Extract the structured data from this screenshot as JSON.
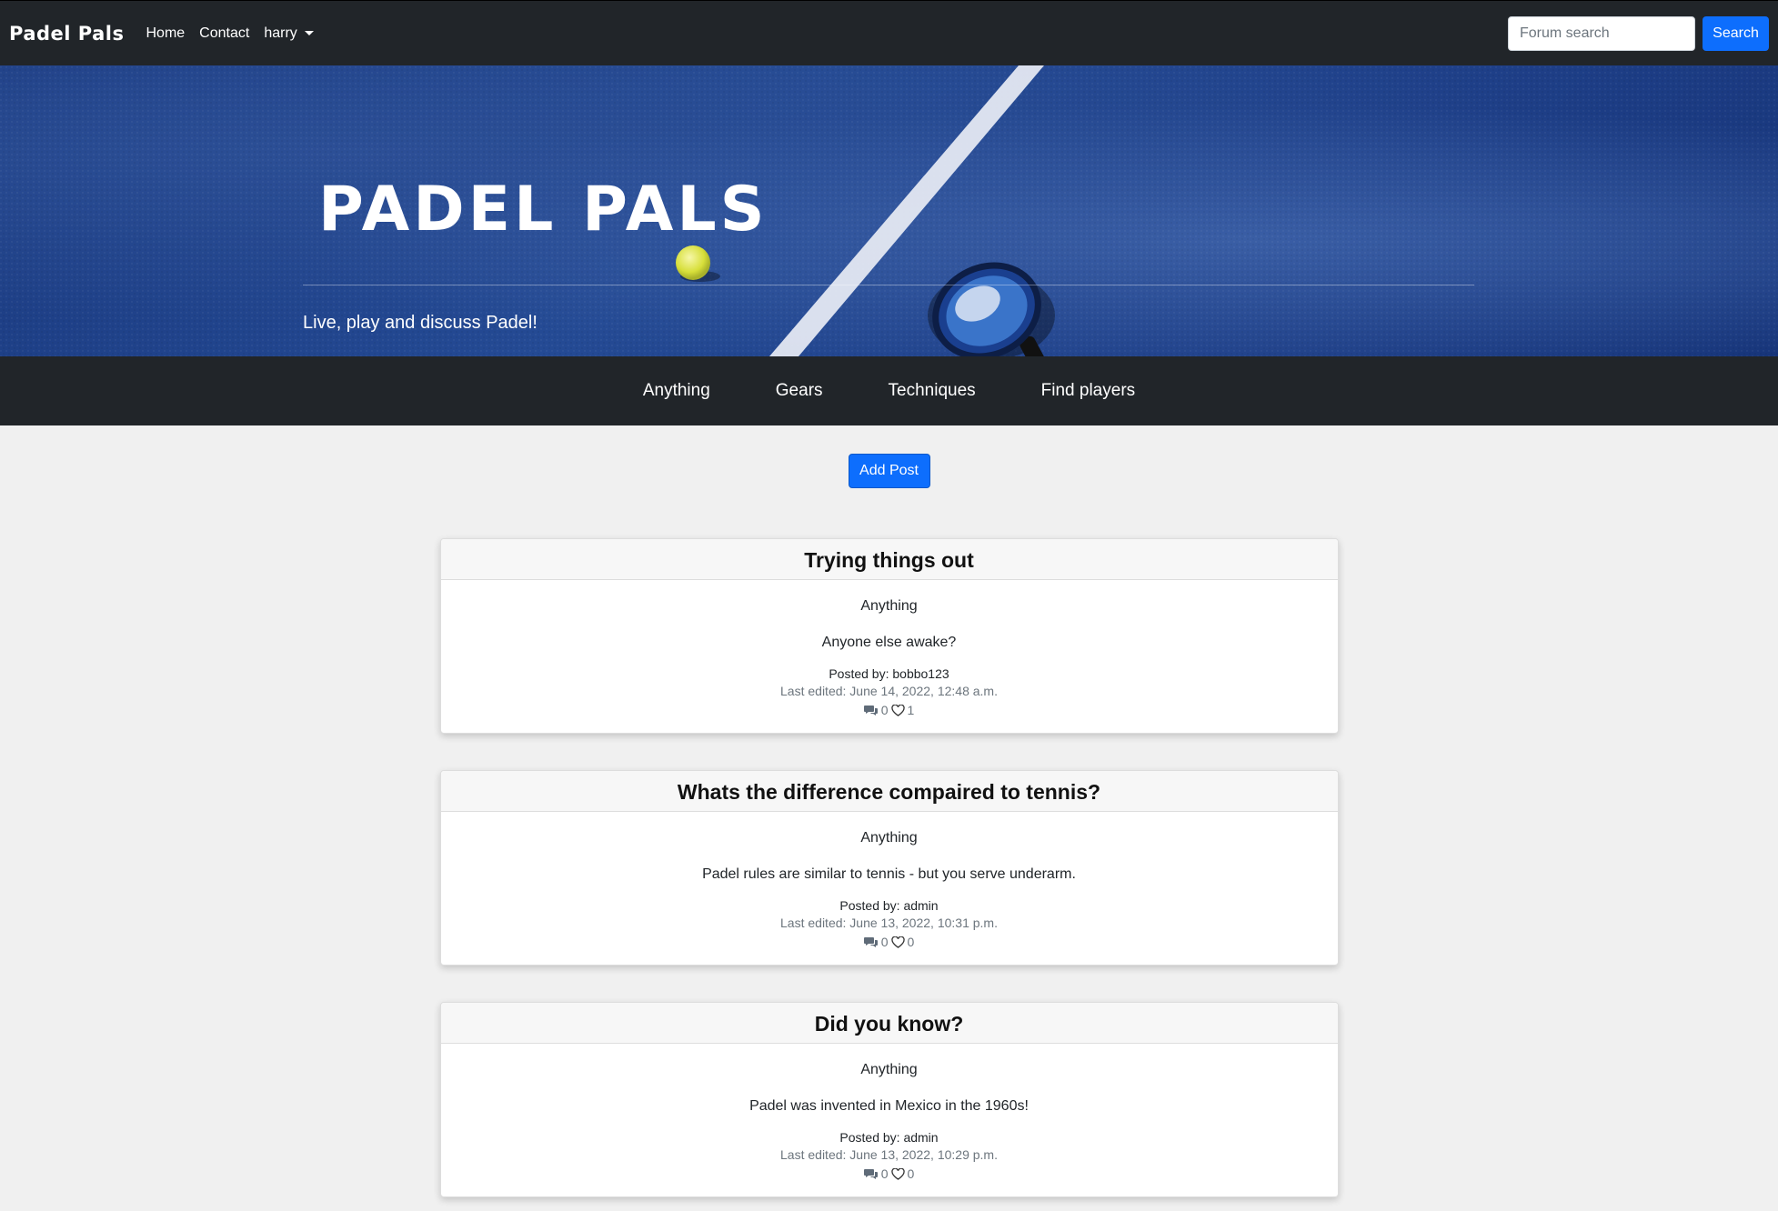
{
  "navbar": {
    "brand": "Padel Pals",
    "links": {
      "home": "Home",
      "contact": "Contact",
      "user": "harry"
    },
    "search": {
      "placeholder": "Forum search",
      "button": "Search"
    }
  },
  "hero": {
    "title": "PADEL PALS",
    "subtitle": "Live, play and discuss Padel!"
  },
  "categories": [
    "Anything",
    "Gears",
    "Techniques",
    "Find players"
  ],
  "add_post_label": "Add Post",
  "posts": [
    {
      "title": "Trying things out",
      "category": "Anything",
      "content": "Anyone else awake?",
      "posted_by": "Posted by: bobbo123",
      "last_edited": "Last edited: June 14, 2022, 12:48 a.m.",
      "comments": "0",
      "likes": "1"
    },
    {
      "title": "Whats the difference compaired to tennis?",
      "category": "Anything",
      "content": "Padel rules are similar to tennis - but you serve underarm.",
      "posted_by": "Posted by: admin",
      "last_edited": "Last edited: June 13, 2022, 10:31 p.m.",
      "comments": "0",
      "likes": "0"
    },
    {
      "title": "Did you know?",
      "category": "Anything",
      "content": "Padel was invented in Mexico in the 1960s!",
      "posted_by": "Posted by: admin",
      "last_edited": "Last edited: June 13, 2022, 10:29 p.m.",
      "comments": "0",
      "likes": "0"
    }
  ],
  "colors": {
    "navbar_bg": "#212529",
    "primary": "#0d6efd",
    "court_blue": "#1f4089",
    "page_bg": "#f0f0f0"
  }
}
